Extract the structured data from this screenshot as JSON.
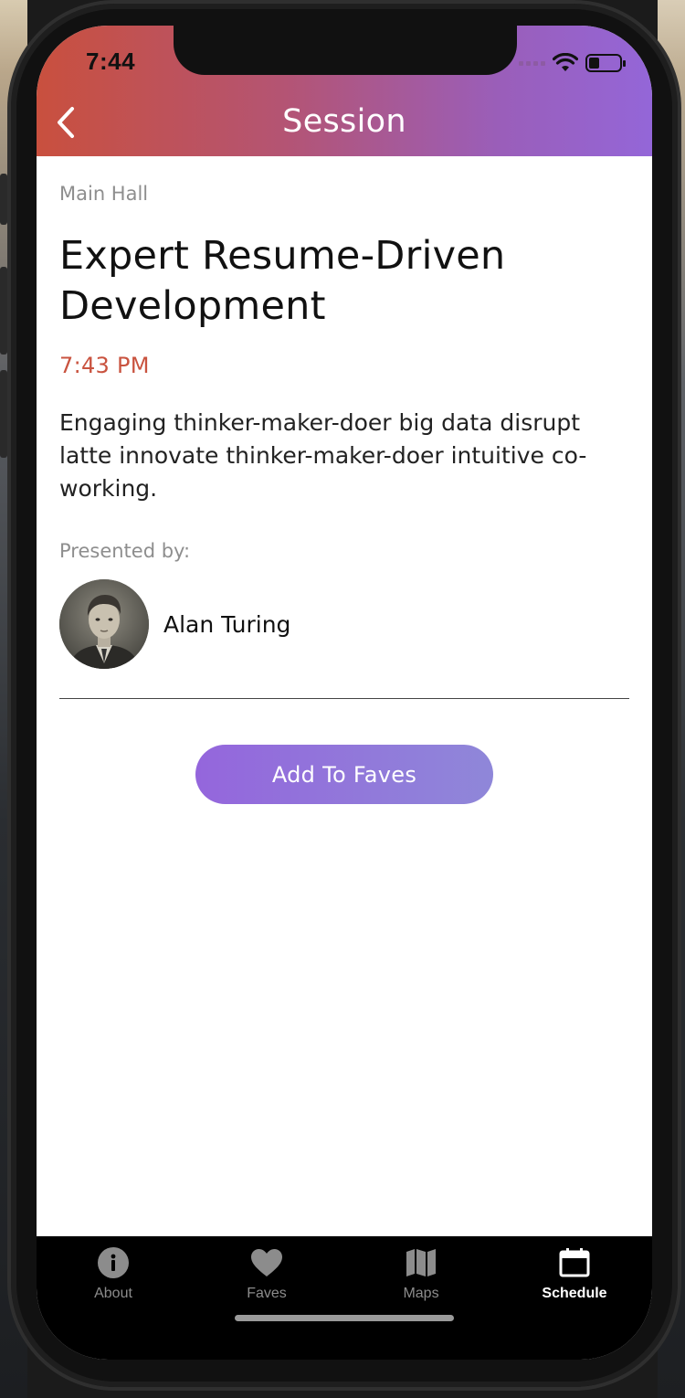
{
  "status": {
    "time": "7:44"
  },
  "nav": {
    "title": "Session",
    "back_icon": "chevron-left-icon"
  },
  "session": {
    "room": "Main Hall",
    "title": "Expert Resume-Driven Development",
    "time": "7:43 PM",
    "description": "Engaging thinker-maker-doer big data disrupt latte innovate thinker-maker-doer intuitive co-working.",
    "presented_by_label": "Presented by:",
    "speaker_name": "Alan Turing"
  },
  "actions": {
    "add_to_faves": "Add To Faves"
  },
  "tabs": [
    {
      "label": "About",
      "icon": "info-icon",
      "active": false
    },
    {
      "label": "Faves",
      "icon": "heart-icon",
      "active": false
    },
    {
      "label": "Maps",
      "icon": "map-icon",
      "active": false
    },
    {
      "label": "Schedule",
      "icon": "calendar-icon",
      "active": true
    }
  ],
  "colors": {
    "header_start": "#c9503e",
    "header_end": "#9466d8",
    "accent_time": "#c9533f",
    "button_start": "#9466dc",
    "button_end": "#8f87d9"
  }
}
